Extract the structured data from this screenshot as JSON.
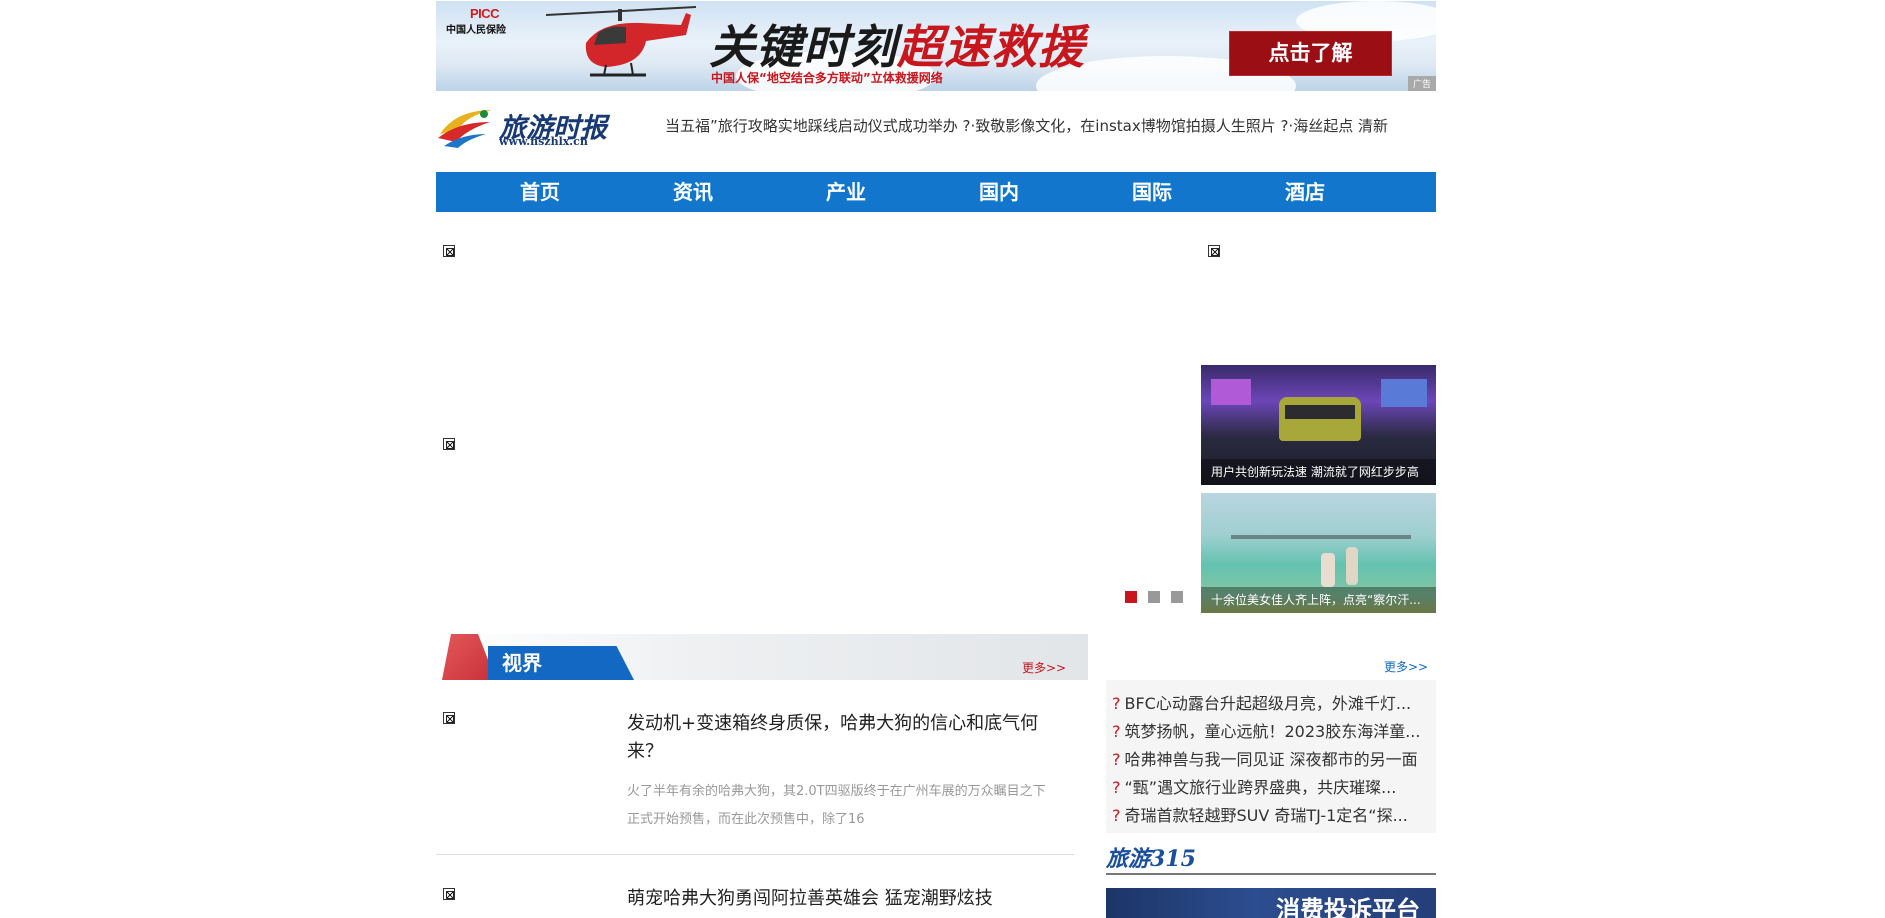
{
  "banner": {
    "brand": "PICC",
    "brand_sub": "中国人民保险",
    "slogan_black": "关键时刻",
    "slogan_red": "超速救援",
    "subline": "中国人保“地空结合多方联动”立体救援网络",
    "button": "点击了解",
    "ad_tag": "广告"
  },
  "logo": {
    "name": "旅游时报",
    "url": "www.nszhlx.cn"
  },
  "ticker": "当五福”旅行攻略实地踩线启动仪式成功举办  ?·致敬影像文化，在instax博物馆拍摄人生照片  ?·海丝起点 清新",
  "nav": [
    "首页",
    "资讯",
    "产业",
    "国内",
    "国际",
    "酒店"
  ],
  "thumbs": [
    {
      "caption": "用户共创新玩法速 潮流就了网红步步高"
    },
    {
      "caption": "十余位美女佳人齐上阵，点亮“察尔汗..."
    }
  ],
  "section": {
    "title": "视界",
    "more": "更多>>"
  },
  "articles": [
    {
      "title": "发动机+变速箱终身质保，哈弗大狗的信心和底气何来？",
      "desc": "火了半年有余的哈弗大狗，其2.0T四驱版终于在广州车展的万众瞩目之下正式开始预售，而在此次预售中，除了16"
    },
    {
      "title": "萌宠哈弗大狗勇闯阿拉善英雄会 猛宠潮野炫技",
      "desc": ""
    }
  ],
  "right_more": "更多>>",
  "news": [
    "BFC心动露台升起超级月亮，外滩千灯...",
    "筑梦扬帆，童心远航！2023胶东海洋童...",
    "哈弗神兽与我一同见证 深夜都市的另一面",
    "“甄”遇文旅行业跨界盛典，共庆璀璨...",
    "奇瑞首款轻越野SUV 奇瑞TJ-1定名“探..."
  ],
  "news_marker": "?",
  "r315": {
    "title": "旅游315",
    "img_text": "消费投诉平台"
  }
}
